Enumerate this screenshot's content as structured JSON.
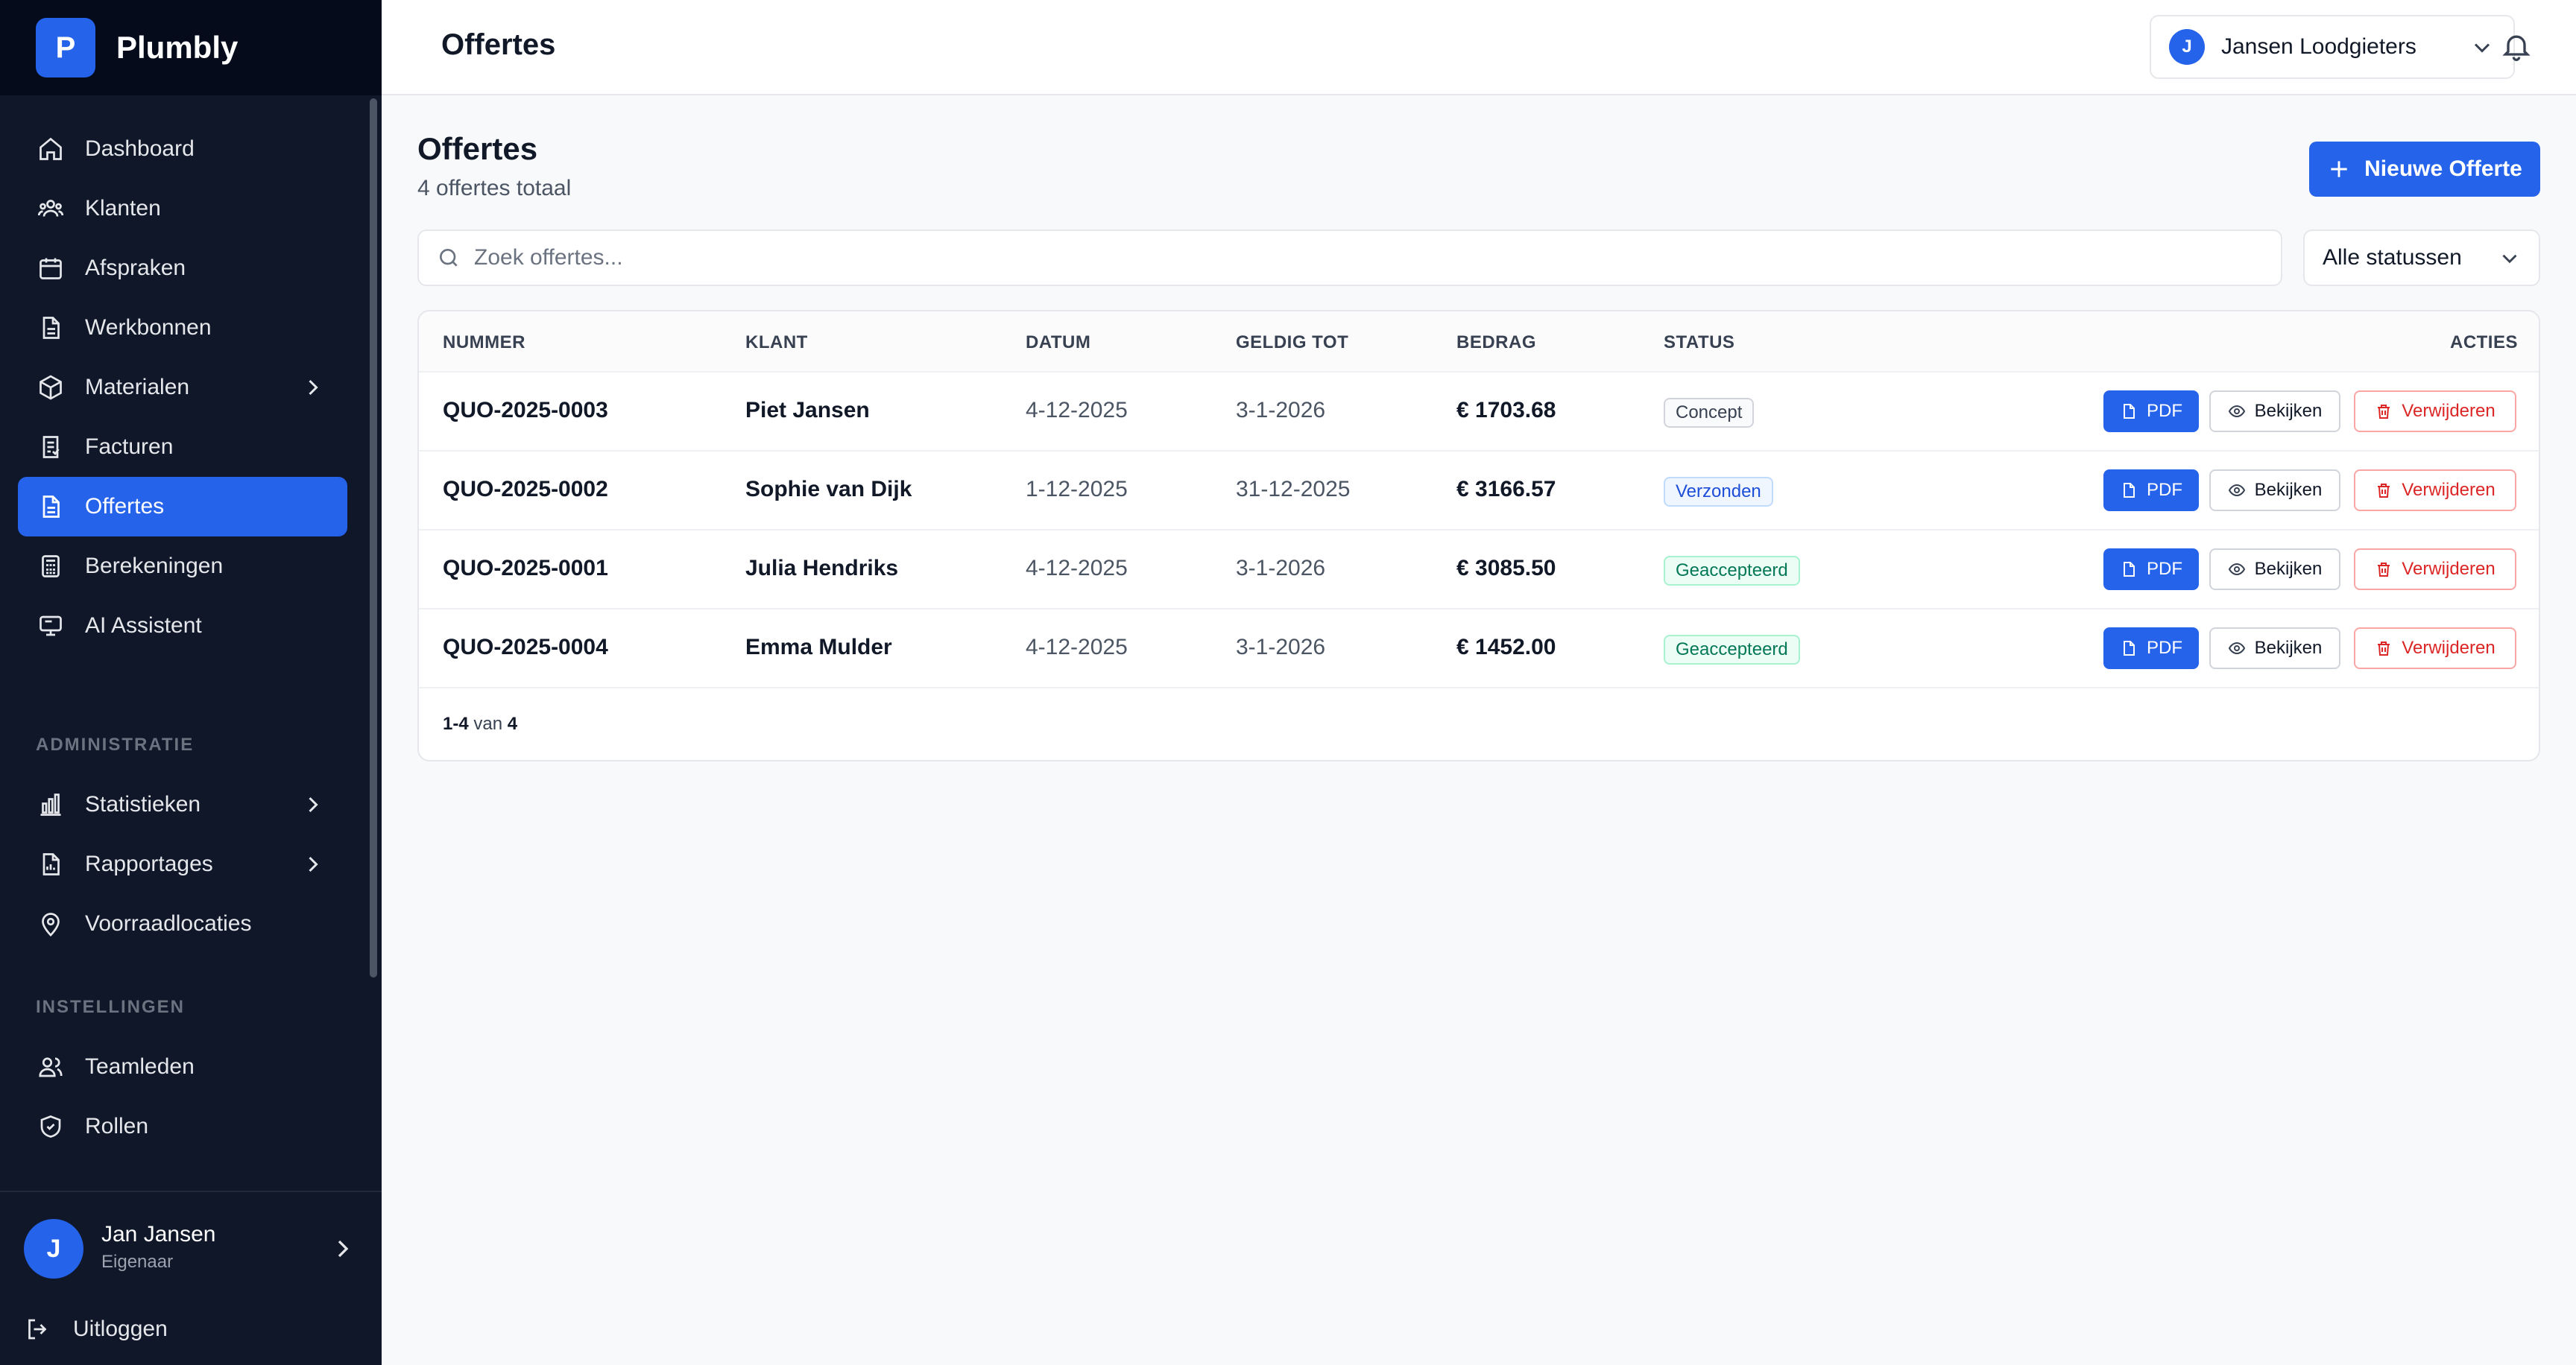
{
  "brand": {
    "letter": "P",
    "name": "Plumbly"
  },
  "sidebar": {
    "items": [
      {
        "label": "Dashboard",
        "icon": "home-icon"
      },
      {
        "label": "Klanten",
        "icon": "users-icon"
      },
      {
        "label": "Afspraken",
        "icon": "calendar-icon"
      },
      {
        "label": "Werkbonnen",
        "icon": "document-icon"
      },
      {
        "label": "Materialen",
        "icon": "box-icon"
      },
      {
        "label": "Facturen",
        "icon": "invoice-icon"
      },
      {
        "label": "Offertes",
        "icon": "document-icon"
      },
      {
        "label": "Berekeningen",
        "icon": "calculator-icon"
      },
      {
        "label": "AI Assistent",
        "icon": "monitor-icon"
      },
      {
        "label": "Statistieken",
        "icon": "bar-chart-icon"
      },
      {
        "label": "Rapportages",
        "icon": "report-icon"
      },
      {
        "label": "Voorraadlocaties",
        "icon": "location-icon"
      },
      {
        "label": "Teamleden",
        "icon": "team-icon"
      },
      {
        "label": "Rollen",
        "icon": "shield-icon"
      }
    ],
    "sections": {
      "admin": "ADMINISTRATIE",
      "settings": "INSTELLINGEN"
    },
    "active_color": "#2563eb"
  },
  "user": {
    "initial": "J",
    "name": "Jan Jansen",
    "role": "Eigenaar",
    "logout_label": "Uitloggen"
  },
  "header": {
    "title": "Offertes",
    "company": {
      "initial": "J",
      "name": "Jansen Loodgieters"
    }
  },
  "main": {
    "title": "Offertes",
    "subtitle": "4 offertes totaal",
    "new_button_label": "Nieuwe Offerte",
    "search_placeholder": "Zoek offertes...",
    "status_filter": "Alle statussen"
  },
  "table": {
    "columns": [
      "NUMMER",
      "KLANT",
      "DATUM",
      "GELDIG TOT",
      "BEDRAG",
      "STATUS",
      "ACTIES"
    ],
    "rows": [
      {
        "number": "QUO-2025-0003",
        "client": "Piet Jansen",
        "date": "4-12-2025",
        "valid_until": "3-1-2026",
        "amount": "€ 1703.68",
        "status": "Concept",
        "status_type": "concept"
      },
      {
        "number": "QUO-2025-0002",
        "client": "Sophie van Dijk",
        "date": "1-12-2025",
        "valid_until": "31-12-2025",
        "amount": "€ 3166.57",
        "status": "Verzonden",
        "status_type": "sent"
      },
      {
        "number": "QUO-2025-0001",
        "client": "Julia Hendriks",
        "date": "4-12-2025",
        "valid_until": "3-1-2026",
        "amount": "€ 3085.50",
        "status": "Geaccepteerd",
        "status_type": "accepted"
      },
      {
        "number": "QUO-2025-0004",
        "client": "Emma Mulder",
        "date": "4-12-2025",
        "valid_until": "3-1-2026",
        "amount": "€ 1452.00",
        "status": "Geaccepteerd",
        "status_type": "accepted"
      }
    ],
    "actions": {
      "pdf": "PDF",
      "view": "Bekijken",
      "delete": "Verwijderen"
    },
    "pagination": {
      "range": "1-4",
      "sep": "van",
      "total": "4"
    }
  }
}
